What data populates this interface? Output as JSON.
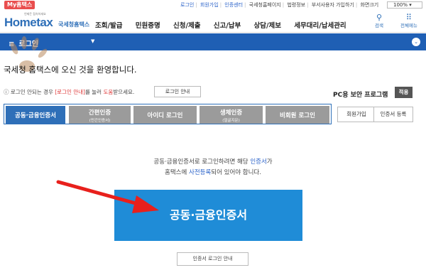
{
  "topbar": {
    "my_tax": "My홈택스",
    "links": [
      "로그인",
      "회원가입",
      "인증센터",
      "국세청홈페이지",
      "법령정보",
      "부서사용자 가입하기",
      "화면크기"
    ],
    "zoom": "100%"
  },
  "header": {
    "logo": "Hometax",
    "logo_tag": "언제든 접속하세요",
    "logo_sub": "국세청홈택스",
    "nav": [
      "조회/발급",
      "민원증명",
      "신청/제출",
      "신고/납부",
      "상담/제보",
      "세무대리/납세관리"
    ],
    "search_label": "검색",
    "menu_label": "전체메뉴"
  },
  "bluebar": {
    "title": "로그인"
  },
  "page": {
    "welcome": "국세청 홈택스에 오신 것을 환영합니다.",
    "note_prefix": "로그인 안되는 경우 ",
    "note_link": "[로그인 안내]",
    "note_mid": "를 눌러 ",
    "note_help": "도움",
    "note_suffix": "받으세요.",
    "login_guide_button": "로그인 안내",
    "security_label": "PC용 보안 프로그램",
    "apply_button": "적용"
  },
  "tabs": [
    {
      "label": "공동·금융인증서",
      "sub": ""
    },
    {
      "label": "간편인증",
      "sub": "(민간인증서)"
    },
    {
      "label": "아이디 로그인",
      "sub": ""
    },
    {
      "label": "생체인증",
      "sub": "(얼굴지문)"
    },
    {
      "label": "비회원 로그인",
      "sub": ""
    }
  ],
  "side_buttons": {
    "join": "회원가입",
    "cert_register": "인증서 등록"
  },
  "message": {
    "line1_prefix": "공동·금융인증서로 로그인하려면 해당 ",
    "line1_link": "인증서",
    "line1_suffix": "가",
    "line2_prefix": "홈택스에 ",
    "line2_link": "사전등록",
    "line2_suffix": "되어 있어야 합니다."
  },
  "main_button": "공동·금융인증서",
  "cert_login_guide": "인증서 로그인 안내",
  "colors": {
    "primary": "#1f5fb4",
    "button": "#1f8cd7",
    "arrow": "#e8201c",
    "tab_inactive": "#9b9b9b"
  }
}
